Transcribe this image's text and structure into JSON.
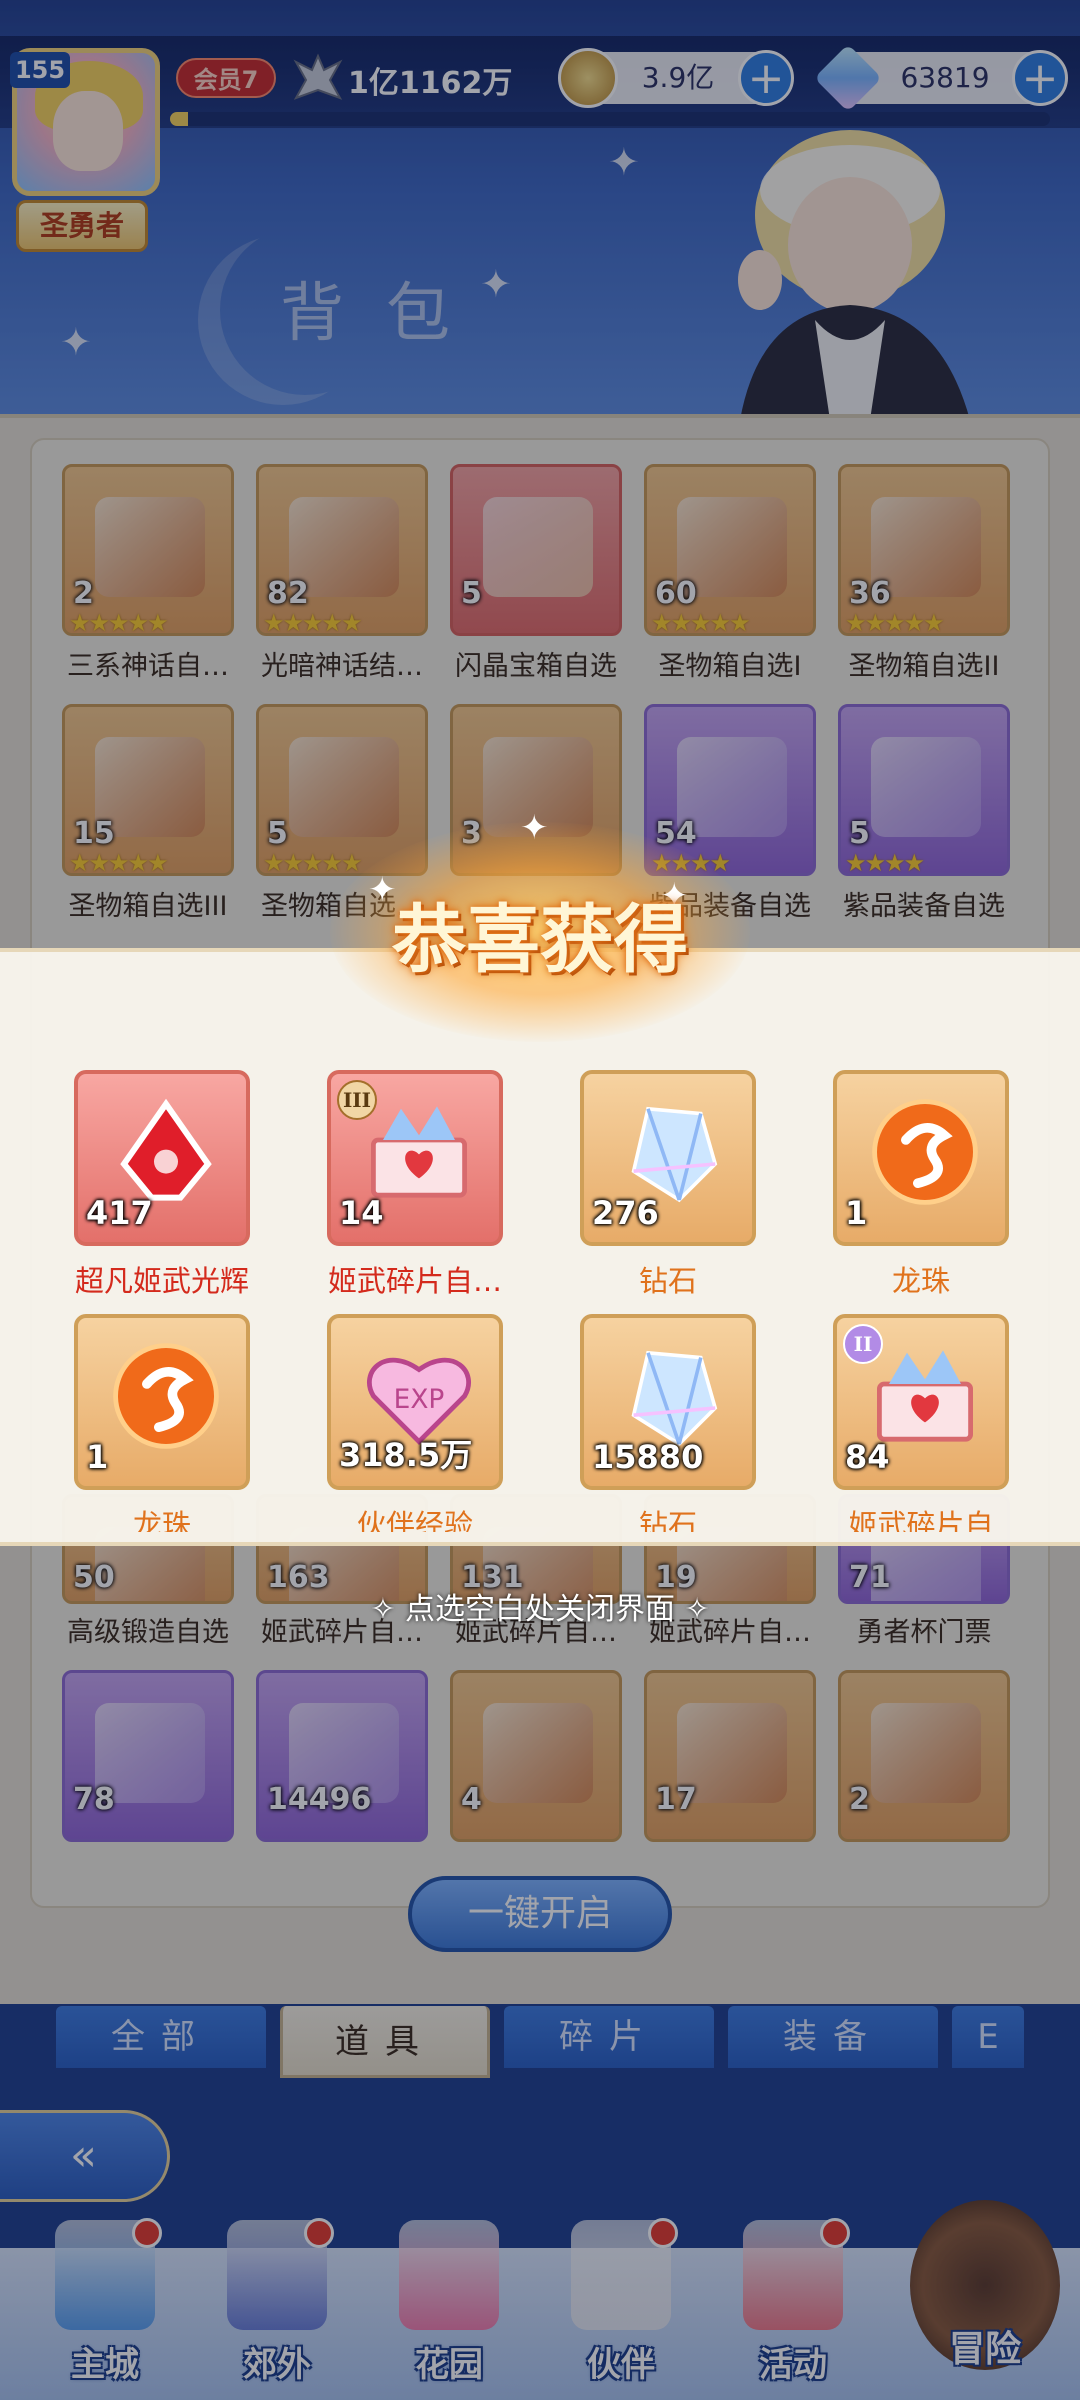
{
  "header": {
    "level": "155",
    "title_badge": "圣勇者",
    "vip": "会员7",
    "power": "1亿1162万",
    "gold": "3.9亿",
    "gems": "63819",
    "page_title": "背包",
    "exp_progress": 0.02
  },
  "inventory": {
    "items": [
      {
        "count": "2",
        "label": "三系神话自…",
        "stars": 5,
        "style": "orange"
      },
      {
        "count": "82",
        "label": "光暗神话结…",
        "stars": 5,
        "style": "orange"
      },
      {
        "count": "5",
        "label": "闪晶宝箱自选",
        "stars": 0,
        "style": "red"
      },
      {
        "count": "60",
        "label": "圣物箱自选I",
        "stars": 5,
        "style": "orange"
      },
      {
        "count": "36",
        "label": "圣物箱自选II",
        "stars": 5,
        "style": "orange"
      },
      {
        "count": "15",
        "label": "圣物箱自选III",
        "stars": 5,
        "style": "orange"
      },
      {
        "count": "5",
        "label": "圣物箱自选…",
        "stars": 5,
        "style": "orange"
      },
      {
        "count": "3",
        "label": "",
        "stars": 0,
        "style": "orange"
      },
      {
        "count": "54",
        "label": "紫品装备自选",
        "stars": 4,
        "style": "purple"
      },
      {
        "count": "5",
        "label": "紫品装备自选",
        "stars": 4,
        "style": "purple"
      },
      {
        "count": "50",
        "label": "高级锻造自选",
        "stars": 0,
        "style": "orange"
      },
      {
        "count": "163",
        "label": "姬武碎片自…",
        "stars": 0,
        "style": "orange"
      },
      {
        "count": "131",
        "label": "姬武碎片自…",
        "stars": 0,
        "style": "orange"
      },
      {
        "count": "19",
        "label": "姬武碎片自…",
        "stars": 0,
        "style": "orange"
      },
      {
        "count": "71",
        "label": "勇者杯门票",
        "stars": 0,
        "style": "purple"
      },
      {
        "count": "78",
        "label": "",
        "stars": 0,
        "style": "purple"
      },
      {
        "count": "14496",
        "label": "",
        "stars": 0,
        "style": "purple"
      },
      {
        "count": "4",
        "label": "",
        "stars": 0,
        "style": "orange"
      },
      {
        "count": "17",
        "label": "",
        "stars": 0,
        "style": "orange"
      },
      {
        "count": "2",
        "label": "",
        "stars": 0,
        "style": "orange"
      }
    ]
  },
  "reward_modal": {
    "title": "恭喜获得",
    "close_hint": "点选空白处关闭界面",
    "rewards": [
      {
        "count": "417",
        "label": "超凡姬武光辉",
        "label_color": "#d42a1c",
        "icon": "red-crystal-icon",
        "style": "red",
        "grade": ""
      },
      {
        "count": "14",
        "label": "姬武碎片自…",
        "label_color": "#d42a1c",
        "icon": "fragment-chest-icon",
        "style": "red",
        "grade": "III"
      },
      {
        "count": "276",
        "label": "钻石",
        "label_color": "#e0721c",
        "icon": "diamond-icon",
        "style": "orange",
        "grade": ""
      },
      {
        "count": "1",
        "label": "龙珠",
        "label_color": "#e0721c",
        "icon": "dragon-orb-icon",
        "style": "orange",
        "grade": ""
      },
      {
        "count": "1",
        "label": "龙珠",
        "label_color": "#e0721c",
        "icon": "dragon-orb-icon",
        "style": "orange",
        "grade": ""
      },
      {
        "count": "318.5万",
        "label": "伙伴经验",
        "label_color": "#e0721c",
        "icon": "exp-heart-icon",
        "style": "orange",
        "grade": ""
      },
      {
        "count": "15880",
        "label": "钻石",
        "label_color": "#e0721c",
        "icon": "diamond-icon",
        "style": "orange",
        "grade": ""
      },
      {
        "count": "84",
        "label": "姬武碎片自",
        "label_color": "#e0721c",
        "icon": "fragment-chest-icon",
        "style": "orange",
        "grade": "II"
      }
    ]
  },
  "open_all_button": "一键开启",
  "tabs": [
    "全部",
    "道具",
    "碎片",
    "装备",
    "E"
  ],
  "active_tab": "道具",
  "nav": [
    {
      "label": "主城",
      "dot": true
    },
    {
      "label": "郊外",
      "dot": true
    },
    {
      "label": "花园",
      "dot": false
    },
    {
      "label": "伙伴",
      "dot": true
    },
    {
      "label": "活动",
      "dot": true
    }
  ],
  "adventure": "冒险",
  "colors": {
    "accent_blue": "#2f7fe0",
    "reward_red": "#d42a1c",
    "reward_orange": "#e0721c"
  }
}
